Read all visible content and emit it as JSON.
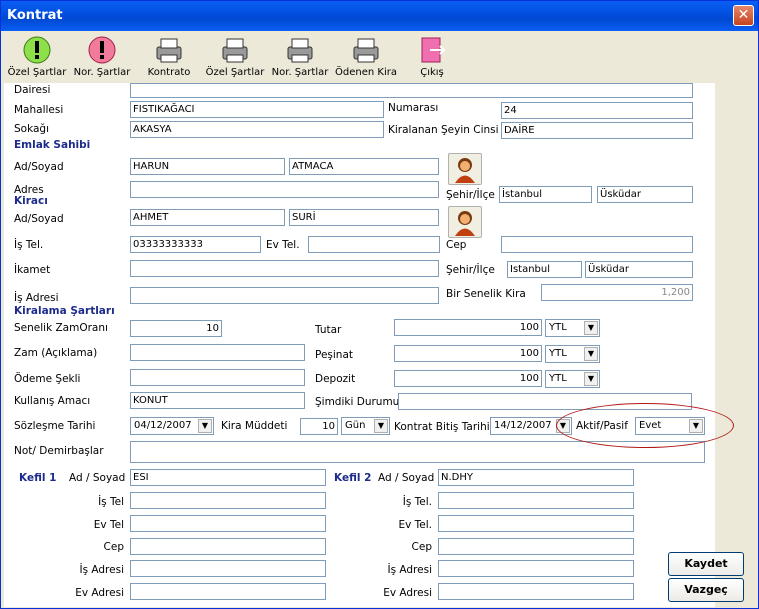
{
  "window": {
    "title": "Kontrat",
    "close_glyph": "✕"
  },
  "toolbar": [
    {
      "label": "Özel Şartlar",
      "icon": "warning-green-icon"
    },
    {
      "label": "Nor. Şartlar",
      "icon": "warning-pink-icon"
    },
    {
      "label": "Kontrato",
      "icon": "printer-icon"
    },
    {
      "label": "Özel Şartlar",
      "icon": "printer-icon"
    },
    {
      "label": "Nor. Şartlar",
      "icon": "printer-icon"
    },
    {
      "label": "Ödenen Kira",
      "icon": "printer-icon"
    },
    {
      "label": "Çıkış",
      "icon": "exit-door-icon"
    }
  ],
  "property": {
    "dairesi_label": "Dairesi",
    "dairesi": "",
    "mahallesi_label": "Mahallesi",
    "mahallesi": "FISTIKAĞACI",
    "numarasi_label": "Numarası",
    "numarasi": "24",
    "sokagi_label": "Sokağı",
    "sokagi": "AKASYA",
    "kiralanan_label": "Kiralanan Şeyin Cinsi",
    "kiralanan": "DAİRE"
  },
  "owner": {
    "section": "Emlak Sahibi",
    "adsoyad_label": "Ad/Soyad",
    "ad": "HARUN",
    "soyad": "ATMACA",
    "adres_label": "Adres",
    "adres": "",
    "sehir_label": "Şehir/İlçe",
    "sehir": "İstanbul",
    "ilce": "Üsküdar"
  },
  "tenant": {
    "section": "Kiracı",
    "adsoyad_label": "Ad/Soyad",
    "ad": "AHMET",
    "soyad": "SURİ",
    "istel_label": "İş Tel.",
    "istel": "03333333333",
    "evtel_label": "Ev Tel.",
    "evtel": "",
    "cep_label": "Cep",
    "cep": "",
    "ikamet_label": "İkamet",
    "ikamet": "",
    "sehir_label": "Şehir/İlçe",
    "sehir": "Istanbul",
    "ilce": "Üsküdar",
    "isadresi_label": "İş Adresi",
    "isadresi": "",
    "senelik_label": "Bir Senelik Kira",
    "senelik": "1,200"
  },
  "terms": {
    "section": "Kiralama Şartları",
    "zamorani_label": "Senelik ZamOranı",
    "zamorani": "10",
    "zam_label": "Zam (Açıklama)",
    "zam": "",
    "odeme_label": "Ödeme Şekli",
    "odeme": "",
    "kullanis_label": "Kullanış Amacı",
    "kullanis": "KONUT",
    "tutar_label": "Tutar",
    "tutar": "100",
    "tutar_cur": "YTL",
    "pesinat_label": "Peşinat",
    "pesinat": "100",
    "pesinat_cur": "YTL",
    "depozit_label": "Depozit",
    "depozit": "100",
    "depozit_cur": "YTL",
    "simdiki_label": "Şimdiki Durumu",
    "simdiki": "",
    "sozlesme_label": "Sözleşme Tarihi",
    "sozlesme": "04/12/2007",
    "muddet_label": "Kira Müddeti",
    "muddet": "10",
    "muddet_unit": "Gün",
    "bitis_label": "Kontrat Bitiş Tarihi",
    "bitis": "14/12/2007",
    "aktif_label": "Aktif/Pasif",
    "aktif": "Evet",
    "not_label": "Not/ Demirbaşlar",
    "not": ""
  },
  "kefil1": {
    "section": "Kefil 1",
    "adsoyad_label": "Ad / Soyad",
    "adsoyad": "ESI",
    "istel_label": "İş Tel",
    "istel": "",
    "evtel_label": "Ev Tel",
    "evtel": "",
    "cep_label": "Cep",
    "cep": "",
    "isadresi_label": "İş Adresi",
    "isadresi": "",
    "evadresi_label": "Ev Adresi",
    "evadresi": ""
  },
  "kefil2": {
    "section": "Kefil 2",
    "adsoyad_label": "Ad / Soyad",
    "adsoyad": "N.DHY",
    "istel_label": "İş Tel.",
    "istel": "",
    "evtel_label": "Ev Tel.",
    "evtel": "",
    "cep_label": "Cep",
    "cep": "",
    "isadresi_label": "İş Adresi",
    "isadresi": "",
    "evadresi_label": "Ev Adresi",
    "evadresi": ""
  },
  "buttons": {
    "save": "Kaydet",
    "cancel": "Vazgeç"
  },
  "colors": {
    "titlebar": "#0A5FF4",
    "section": "#1D2C8C",
    "highlight": "#B01818"
  }
}
